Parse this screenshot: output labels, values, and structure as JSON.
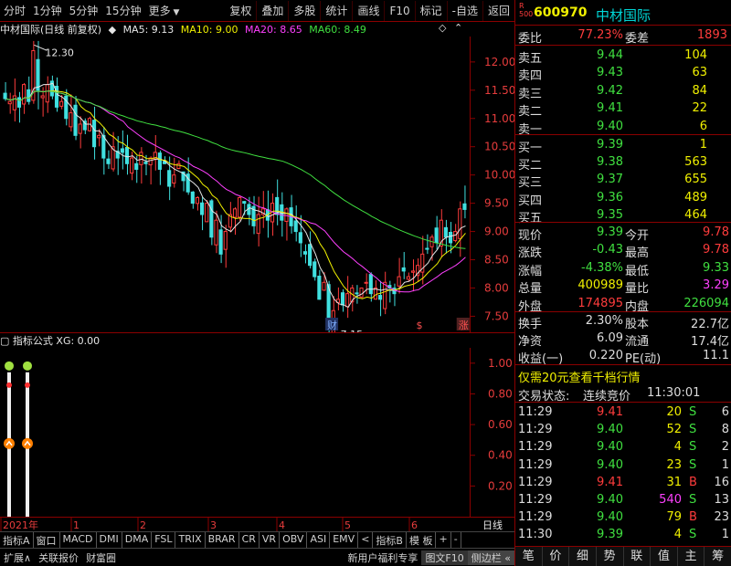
{
  "toolbar": {
    "left": [
      "分时",
      "1分钟",
      "5分钟",
      "15分钟",
      "更多"
    ],
    "right": [
      "复权",
      "叠加",
      "多股",
      "统计",
      "画线",
      "F10",
      "标记",
      "-自选",
      "返回"
    ]
  },
  "chart_header": {
    "title": "中材国际(日线 前复权)",
    "ma5": "MA5: 9.13",
    "ma10": "MA10: 9.00",
    "ma20": "MA20: 8.65",
    "ma60": "MA60: 8.49"
  },
  "indicator_header": {
    "name": "指标公式",
    "value": "XG: 0.00"
  },
  "chart_data": [
    {
      "type": "candlestick",
      "y_ticks": [
        "12.00",
        "11.50",
        "11.00",
        "10.50",
        "10.00",
        "9.50",
        "9.00",
        "8.50",
        "8.00",
        "7.50"
      ],
      "ylim": [
        7.2,
        12.45
      ],
      "high_label": "12.30",
      "low_label": "7.15",
      "marks": [
        "财",
        "$",
        "涨"
      ],
      "x_labels": [
        "2021年",
        "1",
        "2",
        "3",
        "4",
        "5",
        "6"
      ],
      "series": [
        {
          "name": "MA5",
          "color": "#e6e6e6"
        },
        {
          "name": "MA10",
          "color": "#f0f000"
        },
        {
          "name": "MA20",
          "color": "#ff40ff"
        },
        {
          "name": "MA60",
          "color": "#40e040"
        }
      ],
      "close": [
        11.35,
        11.3,
        11.4,
        11.2,
        11.6,
        11.3,
        12.2,
        11.5,
        11.4,
        11.6,
        11.4,
        11.2,
        11.3,
        11.0,
        11.1,
        10.7,
        10.9,
        10.8,
        11.0,
        10.5,
        10.7,
        10.3,
        10.2,
        10.5,
        10.3,
        10.4,
        10.2,
        10.3,
        10.1,
        10.4,
        10.2,
        10.3,
        10.4,
        10.1,
        10.2,
        9.8,
        10.0,
        10.2,
        9.9,
        9.7,
        9.5,
        9.6,
        9.3,
        9.5,
        8.9,
        9.2,
        8.6,
        9.0,
        9.3,
        9.4,
        9.6,
        9.5,
        9.3,
        9.1,
        9.3,
        9.4,
        9.2,
        9.5,
        9.3,
        9.2,
        9.4,
        9.1,
        9.0,
        8.8,
        8.6,
        8.4,
        8.2,
        7.8,
        8.1,
        7.3,
        7.6,
        7.8,
        7.7,
        7.9,
        8.0,
        7.9,
        8.0,
        8.1,
        7.9,
        8.0,
        7.8,
        8.1,
        8.0,
        7.9,
        8.2,
        8.3,
        8.2,
        8.3,
        8.4,
        8.6,
        8.7,
        8.9,
        8.8,
        9.2,
        8.9,
        8.8,
        9.0,
        9.4,
        9.39
      ],
      "ma_values": {
        "MA5": 9.13,
        "MA10": 9.0,
        "MA20": 8.65,
        "MA60": 8.49
      }
    },
    {
      "type": "bar",
      "name": "XG",
      "y_ticks": [
        "1.00",
        "0.80",
        "0.60",
        "0.40",
        "0.20"
      ],
      "ylim": [
        0,
        1.1
      ],
      "values": [
        1,
        1
      ]
    }
  ],
  "date_axis": [
    "2021年",
    "1",
    "2",
    "3",
    "4",
    "5",
    "6"
  ],
  "date_axis_right": "日线",
  "tabs": [
    "指标A",
    "窗口",
    "MACD",
    "DMI",
    "DMA",
    "FSL",
    "TRIX",
    "BRAR",
    "CR",
    "VR",
    "OBV",
    "ASI",
    "EMV",
    "<",
    "指标B",
    "模 板",
    "+",
    "-"
  ],
  "status_bar": {
    "left": [
      "扩展∧",
      "关联报价",
      "财富圈"
    ],
    "right": [
      "新用户福利专享",
      "图文F10",
      "侧边栏 «"
    ]
  },
  "quote": {
    "code": "600970",
    "name": "中材国际",
    "badge_top": "R",
    "badge_bottom": "500",
    "weibi_label": "委比",
    "weibi": "77.23%",
    "weicha_label": "委差",
    "weicha": "1893",
    "asks": [
      {
        "label": "卖五",
        "price": "9.44",
        "vol": "104"
      },
      {
        "label": "卖四",
        "price": "9.43",
        "vol": "63"
      },
      {
        "label": "卖三",
        "price": "9.42",
        "vol": "84"
      },
      {
        "label": "卖二",
        "price": "9.41",
        "vol": "22"
      },
      {
        "label": "卖一",
        "price": "9.40",
        "vol": "6"
      }
    ],
    "bids": [
      {
        "label": "买一",
        "price": "9.39",
        "vol": "1"
      },
      {
        "label": "买二",
        "price": "9.38",
        "vol": "563"
      },
      {
        "label": "买三",
        "price": "9.37",
        "vol": "655"
      },
      {
        "label": "买四",
        "price": "9.36",
        "vol": "489"
      },
      {
        "label": "买五",
        "price": "9.35",
        "vol": "464"
      }
    ],
    "stats": [
      {
        "l1": "现价",
        "v1": "9.39",
        "l2": "今开",
        "v2": "9.78"
      },
      {
        "l1": "涨跌",
        "v1": "-0.43",
        "l2": "最高",
        "v2": "9.78"
      },
      {
        "l1": "涨幅",
        "v1": "-4.38%",
        "l2": "最低",
        "v2": "9.33"
      },
      {
        "l1": "总量",
        "v1": "400989",
        "l2": "量比",
        "v2": "3.29"
      },
      {
        "l1": "外盘",
        "v1": "174895",
        "l2": "内盘",
        "v2": "226094"
      }
    ],
    "stats2": [
      {
        "l1": "换手",
        "v1": "2.30%",
        "l2": "股本",
        "v2": "22.7亿"
      },
      {
        "l1": "净资",
        "v1": "6.09",
        "l2": "流通",
        "v2": "17.4亿"
      },
      {
        "l1": "收益(一)",
        "v1": "0.220",
        "l2": "PE(动)",
        "v2": "11.1"
      }
    ],
    "promo": "仅需20元查看千档行情",
    "state_label": "交易状态:",
    "state_value": "连续竞价",
    "state_time": "11:30:01",
    "ticks": [
      {
        "t": "11:29",
        "p": "9.41",
        "v": "20",
        "d": "S",
        "n": "6"
      },
      {
        "t": "11:29",
        "p": "9.40",
        "v": "52",
        "d": "S",
        "n": "8"
      },
      {
        "t": "11:29",
        "p": "9.40",
        "v": "4",
        "d": "S",
        "n": "2"
      },
      {
        "t": "11:29",
        "p": "9.40",
        "v": "23",
        "d": "S",
        "n": "1"
      },
      {
        "t": "11:29",
        "p": "9.41",
        "v": "31",
        "d": "B",
        "n": "16"
      },
      {
        "t": "11:29",
        "p": "9.40",
        "v": "540",
        "d": "S",
        "n": "13"
      },
      {
        "t": "11:29",
        "p": "9.40",
        "v": "79",
        "d": "B",
        "n": "23"
      },
      {
        "t": "11:30",
        "p": "9.39",
        "v": "4",
        "d": "S",
        "n": "1"
      }
    ],
    "bottom_tabs": [
      "笔",
      "价",
      "细",
      "势",
      "联",
      "值",
      "主",
      "筹"
    ]
  }
}
